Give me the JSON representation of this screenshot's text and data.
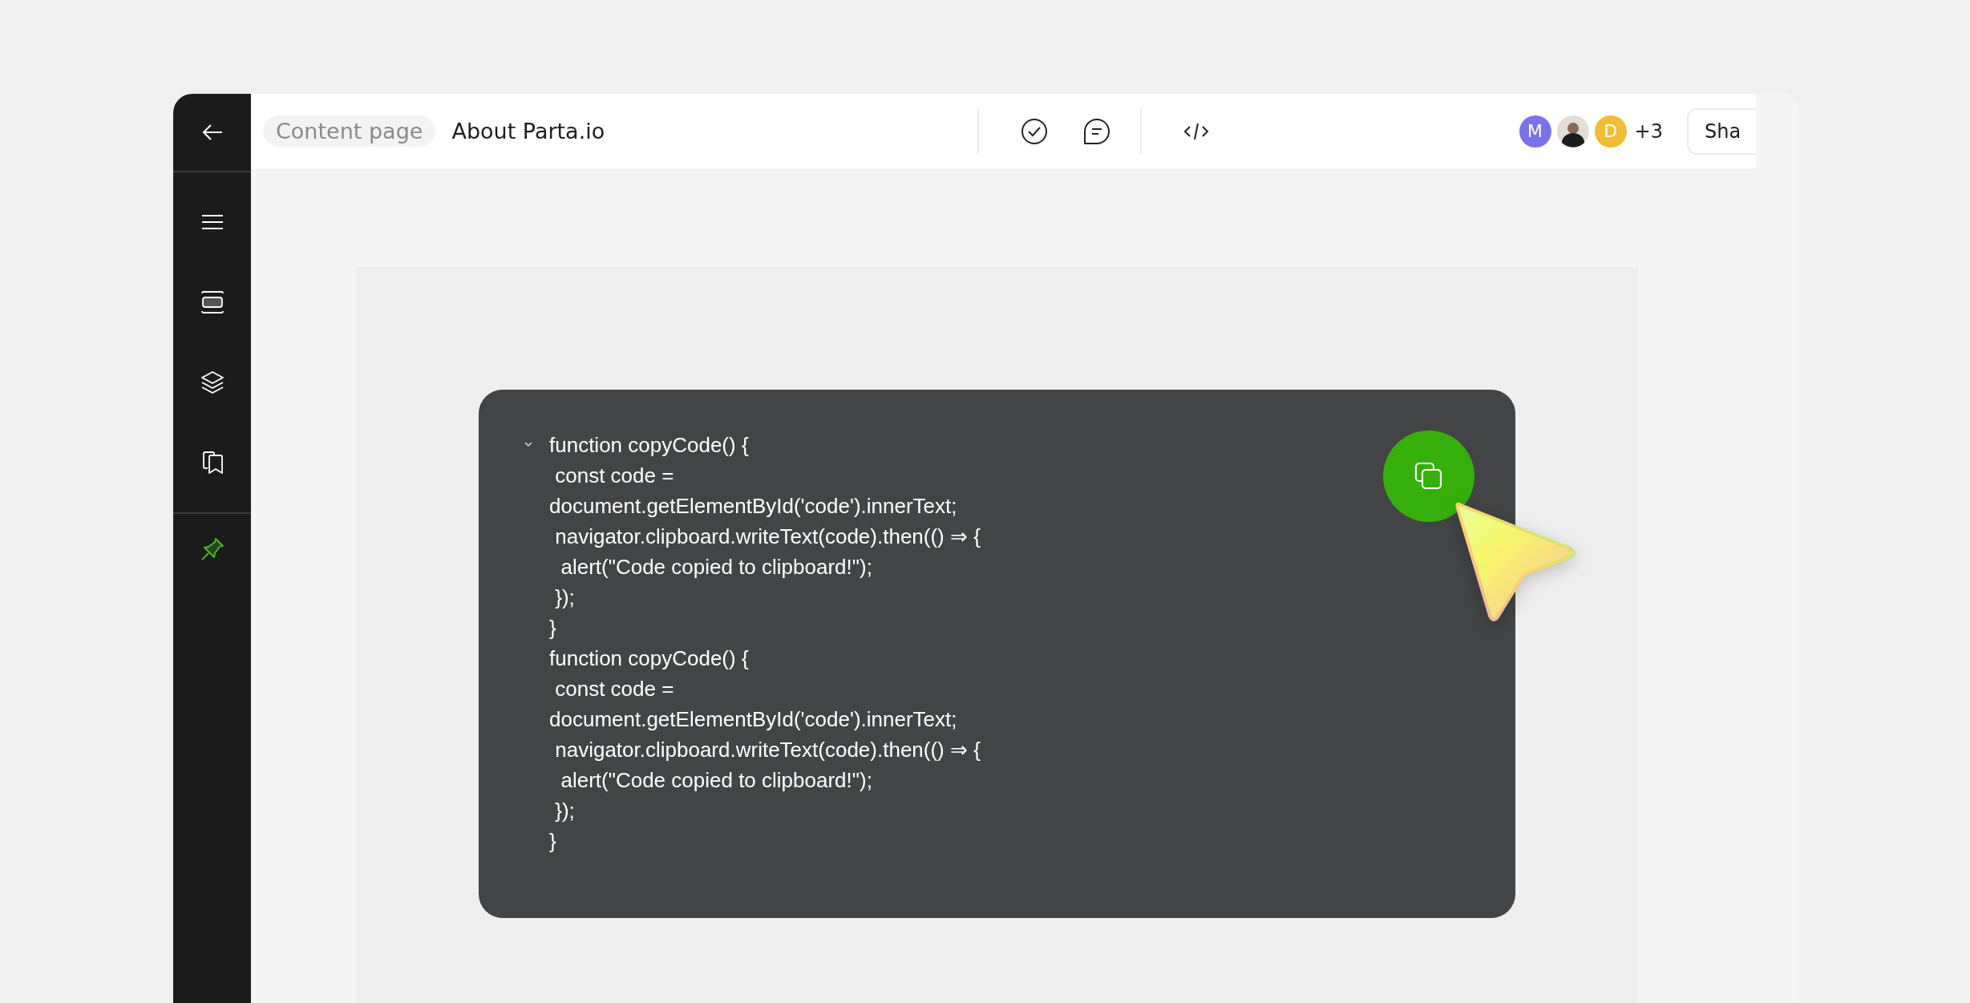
{
  "sidebar": {
    "pin_active": true
  },
  "topbar": {
    "breadcrumb": "Content page",
    "title": "About Parta.io",
    "avatars": [
      {
        "kind": "initial",
        "initial": "M",
        "color": "#7a71ef"
      },
      {
        "kind": "photo"
      },
      {
        "kind": "initial",
        "initial": "D",
        "color": "#f2bd35"
      }
    ],
    "more_count": "+3",
    "share_button": "Sha"
  },
  "code_block": {
    "expanded": true,
    "lines": [
      "function copyCode() {",
      " const code =",
      "document.getElementById('code').innerText;",
      " navigator.clipboard.writeText(code).then(() ⇒ {",
      "  alert(\"Code copied to clipboard!\");",
      " });",
      "}",
      "function copyCode() {",
      " const code =",
      "document.getElementById('code').innerText;",
      " navigator.clipboard.writeText(code).then(() ⇒ {",
      "  alert(\"Code copied to clipboard!\");",
      " });",
      "}"
    ]
  }
}
